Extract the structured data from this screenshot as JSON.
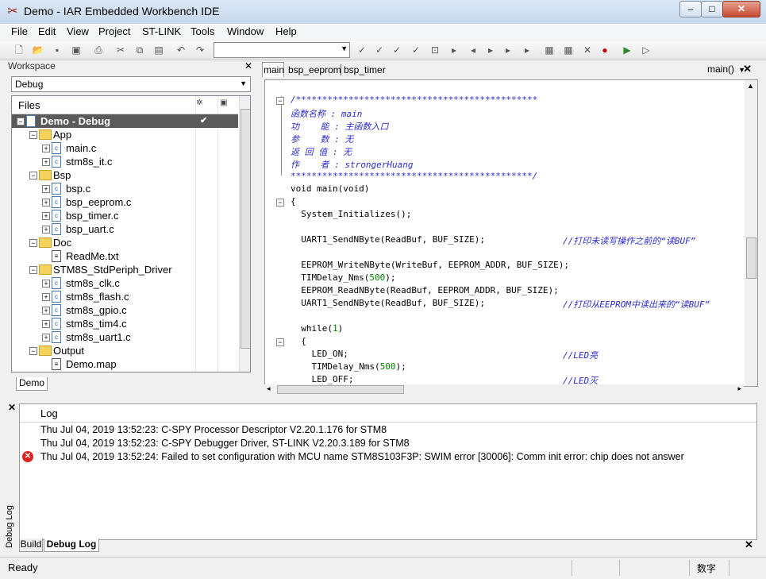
{
  "window": {
    "title": "Demo - IAR Embedded Workbench IDE",
    "min": "–",
    "max": "□",
    "close": "✕"
  },
  "menu": [
    "File",
    "Edit",
    "View",
    "Project",
    "ST-LINK",
    "Tools",
    "Window",
    "Help"
  ],
  "workspace": {
    "header": "Workspace",
    "config": "Debug",
    "files_header": "Files",
    "tab": "Demo",
    "tree": [
      {
        "label": "Demo - Debug",
        "depth": 0,
        "kind": "project",
        "expand": "−",
        "selected": true,
        "check": "✔"
      },
      {
        "label": "App",
        "depth": 1,
        "kind": "folder",
        "expand": "−"
      },
      {
        "label": "main.c",
        "depth": 2,
        "kind": "c",
        "expand": "+"
      },
      {
        "label": "stm8s_it.c",
        "depth": 2,
        "kind": "c",
        "expand": "+"
      },
      {
        "label": "Bsp",
        "depth": 1,
        "kind": "folder",
        "expand": "−"
      },
      {
        "label": "bsp.c",
        "depth": 2,
        "kind": "c",
        "expand": "+"
      },
      {
        "label": "bsp_eeprom.c",
        "depth": 2,
        "kind": "c",
        "expand": "+"
      },
      {
        "label": "bsp_timer.c",
        "depth": 2,
        "kind": "c",
        "expand": "+"
      },
      {
        "label": "bsp_uart.c",
        "depth": 2,
        "kind": "c",
        "expand": "+"
      },
      {
        "label": "Doc",
        "depth": 1,
        "kind": "folder",
        "expand": "−"
      },
      {
        "label": "ReadMe.txt",
        "depth": 2,
        "kind": "txt",
        "expand": ""
      },
      {
        "label": "STM8S_StdPeriph_Driver",
        "depth": 1,
        "kind": "folder",
        "expand": "−"
      },
      {
        "label": "stm8s_clk.c",
        "depth": 2,
        "kind": "c",
        "expand": "+"
      },
      {
        "label": "stm8s_flash.c",
        "depth": 2,
        "kind": "c",
        "expand": "+"
      },
      {
        "label": "stm8s_gpio.c",
        "depth": 2,
        "kind": "c",
        "expand": "+"
      },
      {
        "label": "stm8s_tim4.c",
        "depth": 2,
        "kind": "c",
        "expand": "+"
      },
      {
        "label": "stm8s_uart1.c",
        "depth": 2,
        "kind": "c",
        "expand": "+"
      },
      {
        "label": "Output",
        "depth": 1,
        "kind": "folder",
        "expand": "−"
      },
      {
        "label": "Demo.map",
        "depth": 2,
        "kind": "txt",
        "expand": ""
      }
    ]
  },
  "editor": {
    "tabs": [
      "main",
      "bsp_eeprom",
      "bsp_timer"
    ],
    "function_selector": "main()",
    "lines": [
      {
        "code": "/**********************************************",
        "comment": "",
        "fold": "−",
        "cstyle": true
      },
      {
        "code": "函数名称 : main",
        "comment": "",
        "cstyle": true
      },
      {
        "code": "功    能 : 主函数入口",
        "comment": "",
        "cstyle": true
      },
      {
        "code": "参    数 : 无",
        "comment": "",
        "cstyle": true
      },
      {
        "code": "返 回 值 : 无",
        "comment": "",
        "cstyle": true
      },
      {
        "code": "作    者 : strongerHuang",
        "comment": "",
        "cstyle": true
      },
      {
        "code": "**********************************************/",
        "comment": "",
        "cstyle": true
      },
      {
        "code": "void main(void)",
        "comment": ""
      },
      {
        "code": "{",
        "comment": "",
        "fold": "−"
      },
      {
        "code": "  System_Initializes();",
        "comment": ""
      },
      {
        "code": "",
        "comment": ""
      },
      {
        "code": "  UART1_SendNByte(ReadBuf, BUF_SIZE);",
        "comment": "//打印未读写操作之前的“读BUF”"
      },
      {
        "code": "",
        "comment": ""
      },
      {
        "code": "  EEPROM_WriteNByte(WriteBuf, EEPROM_ADDR, BUF_SIZE);",
        "comment": ""
      },
      {
        "code": "  TIMDelay_Nms(500);",
        "comment": ""
      },
      {
        "code": "  EEPROM_ReadNByte(ReadBuf, EEPROM_ADDR, BUF_SIZE);",
        "comment": ""
      },
      {
        "code": "  UART1_SendNByte(ReadBuf, BUF_SIZE);",
        "comment": "//打印从EEPROM中读出来的“读BUF”"
      },
      {
        "code": "",
        "comment": ""
      },
      {
        "code": "  while(1)",
        "comment": ""
      },
      {
        "code": "  {",
        "comment": "",
        "fold": "−"
      },
      {
        "code": "    LED_ON;",
        "comment": "//LED亮"
      },
      {
        "code": "    TIMDelay_Nms(500);",
        "comment": ""
      },
      {
        "code": "    LED_OFF;",
        "comment": "//LED灭"
      }
    ]
  },
  "log": {
    "header": "Log",
    "side_label": "Debug Log",
    "lines": [
      {
        "text": "Thu Jul 04, 2019 13:52:23: C-SPY Processor Descriptor V2.20.1.176 for STM8",
        "error": false
      },
      {
        "text": "Thu Jul 04, 2019 13:52:23: C-SPY Debugger Driver, ST-LINK V2.20.3.189 for STM8",
        "error": false
      },
      {
        "text": "Thu Jul 04, 2019 13:52:24: Failed to set configuration with MCU name STM8S103F3P: SWIM error [30006]: Comm init error: chip does not answer",
        "error": true
      }
    ],
    "tabs": [
      "Build",
      "Debug Log"
    ]
  },
  "status": {
    "ready": "Ready",
    "ime": "数字"
  },
  "colors": {
    "comment": "#2b2bcb",
    "number": "#008000",
    "error": "#dd2222",
    "folder": "#f5d25b"
  }
}
